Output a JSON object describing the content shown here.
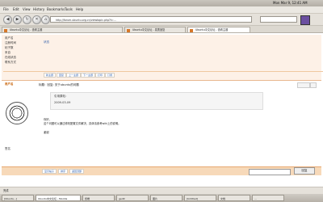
{
  "top_panel": {
    "clock": "Mon Mar  9, 12:41 AM"
  },
  "menubar": {
    "items": [
      "File",
      "Edit",
      "View",
      "History",
      "Bookmarks",
      "Tools",
      "Help"
    ]
  },
  "navbar": {
    "url": "http://forum.ubuntu.org.cn/viewtopic.php?t=...",
    "search_placeholder": ""
  },
  "tabs": [
    {
      "label": "Ubuntu中文论坛 - 查看主题"
    },
    {
      "label": "Ubuntu中文论坛 - 发表回复"
    },
    {
      "label": "Ubuntu中文论坛 - 查看主题"
    }
  ],
  "profile": {
    "lines": [
      "用户名",
      "注册时间",
      "帖子数",
      "来自",
      "在线状态",
      "联系方式"
    ],
    "tag": "状态"
  },
  "thread_buttons": [
    "新主题",
    "回复",
    "上一主题",
    "下一主题",
    "打印",
    "订阅"
  ],
  "post": {
    "author": "用户名",
    "title": "标题：回复: 关于ubuntu的问题",
    "quote": [
      "引用原帖：",
      "2009-03-09"
    ],
    "body": [
      "你好，",
      "这个问题可以通过修改配置文件解决，具体请参考wiki上的说明。",
      "谢谢"
    ],
    "sig": [
      "签名"
    ]
  },
  "footer": {
    "reply_label": "回复",
    "links": [
      "显示帖子",
      "排序",
      "返回顶部"
    ]
  },
  "status": {
    "text": "完成"
  },
  "taskbar": {
    "items": [
      "[Ubuntu...]",
      "Ubuntu中文论坛 - Mozilla",
      "终端",
      "gedit",
      "图片",
      "[Untitled]",
      "文档",
      "..."
    ]
  }
}
